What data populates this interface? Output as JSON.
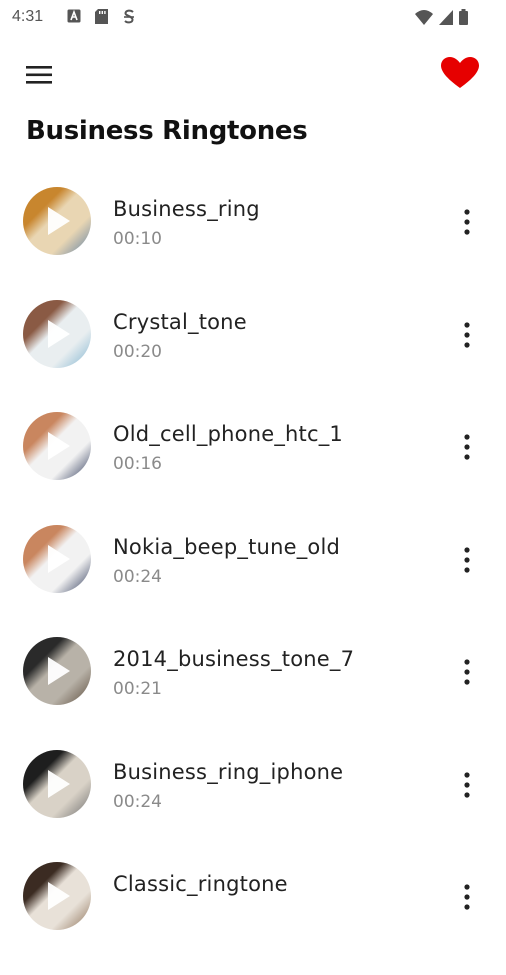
{
  "status_bar": {
    "time": "4:31",
    "left_icons": [
      "a-badge-icon",
      "sd-card-icon",
      "s-circle-icon"
    ],
    "right_icons": [
      "wifi-icon",
      "cell-signal-icon",
      "battery-icon"
    ]
  },
  "app_bar": {
    "menu_icon": "hamburger-menu-icon",
    "favorite_icon": "heart-icon",
    "favorite_color": "#e60000"
  },
  "page": {
    "title": "Business Ringtones"
  },
  "ringtones": [
    {
      "title": "Business_ring",
      "duration": "00:10",
      "thumb_colors": [
        "#c8862e",
        "#e9d6b3",
        "#5c7ea3"
      ]
    },
    {
      "title": "Crystal_tone",
      "duration": "00:20",
      "thumb_colors": [
        "#8a5a44",
        "#e9eef0",
        "#7fb3cf"
      ]
    },
    {
      "title": "Old_cell_phone_htc_1",
      "duration": "00:16",
      "thumb_colors": [
        "#c9865f",
        "#f2f2f2",
        "#2a3556"
      ]
    },
    {
      "title": "Nokia_beep_tune_old",
      "duration": "00:24",
      "thumb_colors": [
        "#c9865f",
        "#f2f2f2",
        "#2a3556"
      ]
    },
    {
      "title": "2014_business_tone_7",
      "duration": "00:21",
      "thumb_colors": [
        "#2a2a2a",
        "#b8b2a8",
        "#5a4a3a"
      ]
    },
    {
      "title": "Business_ring_iphone",
      "duration": "00:24",
      "thumb_colors": [
        "#1e1e1e",
        "#d9d2c7",
        "#6b6b6b"
      ]
    },
    {
      "title": "Classic_ringtone",
      "duration": "",
      "thumb_colors": [
        "#3b2b22",
        "#e8e1d8",
        "#8b6f55"
      ]
    }
  ]
}
